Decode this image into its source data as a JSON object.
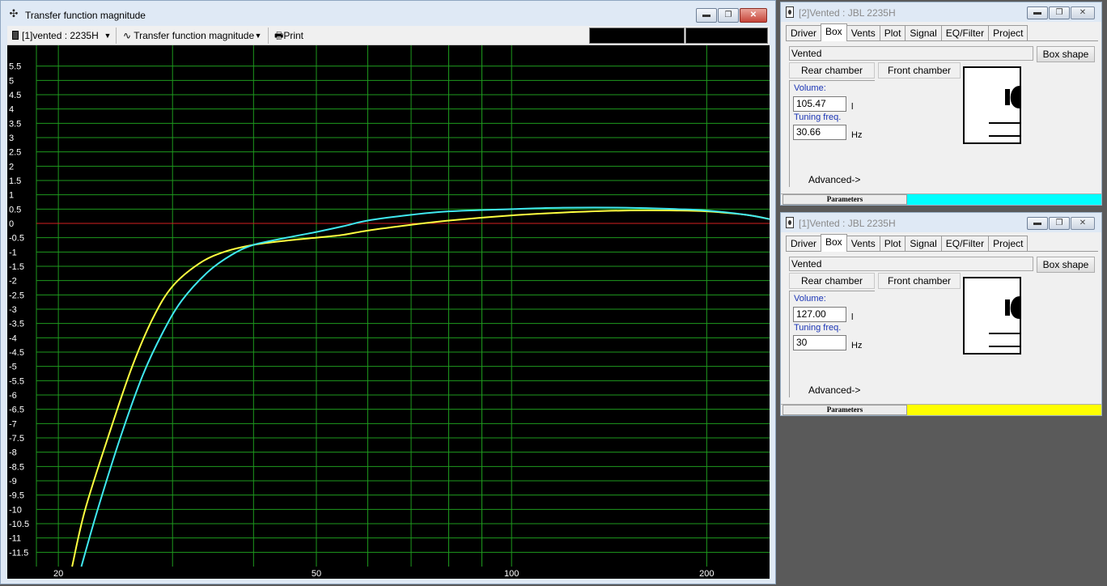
{
  "main_window": {
    "title": "Transfer function magnitude",
    "toolbar": {
      "project_select": "[1]vented : 2235H",
      "plot_select": "Transfer function magnitude",
      "print_label": "Print"
    }
  },
  "chart_data": {
    "type": "line",
    "title": "",
    "xlabel": "",
    "ylabel": "",
    "x_scale": "log",
    "xlim": [
      18.5,
      250
    ],
    "ylim": [
      -12,
      6
    ],
    "y_ticks": [
      5.5,
      5,
      4.5,
      4,
      3.5,
      3,
      2.5,
      2,
      1.5,
      1,
      0.5,
      0,
      -0.5,
      -1,
      -1.5,
      -2,
      -2.5,
      -3,
      -3.5,
      -4,
      -4.5,
      -5,
      -5.5,
      -6,
      -6.5,
      -7,
      -7.5,
      -8,
      -8.5,
      -9,
      -9.5,
      -10,
      -10.5,
      -11,
      -11.5
    ],
    "x_tick_labels": [
      {
        "value": 20,
        "label": "20"
      },
      {
        "value": 50,
        "label": "50"
      },
      {
        "value": 100,
        "label": "100"
      },
      {
        "value": 200,
        "label": "200"
      }
    ],
    "x_grid": [
      20,
      30,
      40,
      50,
      60,
      70,
      80,
      90,
      100,
      200
    ],
    "grid": true,
    "grid_color": "#1e9a1e",
    "reference_line": {
      "y": 0,
      "color": "#d42020"
    },
    "series": [
      {
        "color": "#ffff40",
        "x": [
          21,
          22,
          24,
          26,
          28,
          30,
          33,
          36,
          40,
          45,
          50,
          55,
          60,
          70,
          80,
          100,
          120,
          150,
          180,
          200,
          230,
          250
        ],
        "y": [
          -12,
          -10,
          -7.3,
          -5.0,
          -3.3,
          -2.2,
          -1.4,
          -1.0,
          -0.75,
          -0.6,
          -0.5,
          -0.4,
          -0.25,
          -0.05,
          0.1,
          0.28,
          0.38,
          0.45,
          0.45,
          0.42,
          0.3,
          0.15
        ]
      },
      {
        "color": "#40e8f0",
        "x": [
          21.7,
          23,
          25,
          27,
          29,
          31,
          34,
          37,
          40,
          45,
          50,
          55,
          60,
          70,
          80,
          100,
          120,
          150,
          180,
          200,
          230,
          250
        ],
        "y": [
          -12,
          -10,
          -7.4,
          -5.3,
          -3.8,
          -2.7,
          -1.7,
          -1.1,
          -0.75,
          -0.5,
          -0.3,
          -0.1,
          0.1,
          0.3,
          0.42,
          0.5,
          0.55,
          0.55,
          0.5,
          0.45,
          0.3,
          0.15
        ]
      }
    ]
  },
  "panels": [
    {
      "title": "[2]Vented : JBL 2235H",
      "tabs": [
        "Driver",
        "Box",
        "Vents",
        "Plot",
        "Signal",
        "EQ/Filter",
        "Project"
      ],
      "active_tab": "Box",
      "box_type": "Vented",
      "box_shape_label": "Box shape",
      "rear_chamber_label": "Rear chamber",
      "front_chamber_label": "Front chamber",
      "volume_label": "Volume:",
      "volume_value": "105.47",
      "volume_unit": "l",
      "tuning_label": "Tuning freq.",
      "tuning_value": "30.66",
      "tuning_unit": "Hz",
      "advanced_label": "Advanced->",
      "status_label": "Parameters",
      "color": "#00ffff"
    },
    {
      "title": "[1]Vented : JBL 2235H",
      "tabs": [
        "Driver",
        "Box",
        "Vents",
        "Plot",
        "Signal",
        "EQ/Filter",
        "Project"
      ],
      "active_tab": "Box",
      "box_type": "Vented",
      "box_shape_label": "Box shape",
      "rear_chamber_label": "Rear chamber",
      "front_chamber_label": "Front chamber",
      "volume_label": "Volume:",
      "volume_value": "127.00",
      "volume_unit": "l",
      "tuning_label": "Tuning freq.",
      "tuning_value": "30",
      "tuning_unit": "Hz",
      "advanced_label": "Advanced->",
      "status_label": "Parameters",
      "color": "#ffff00"
    }
  ]
}
